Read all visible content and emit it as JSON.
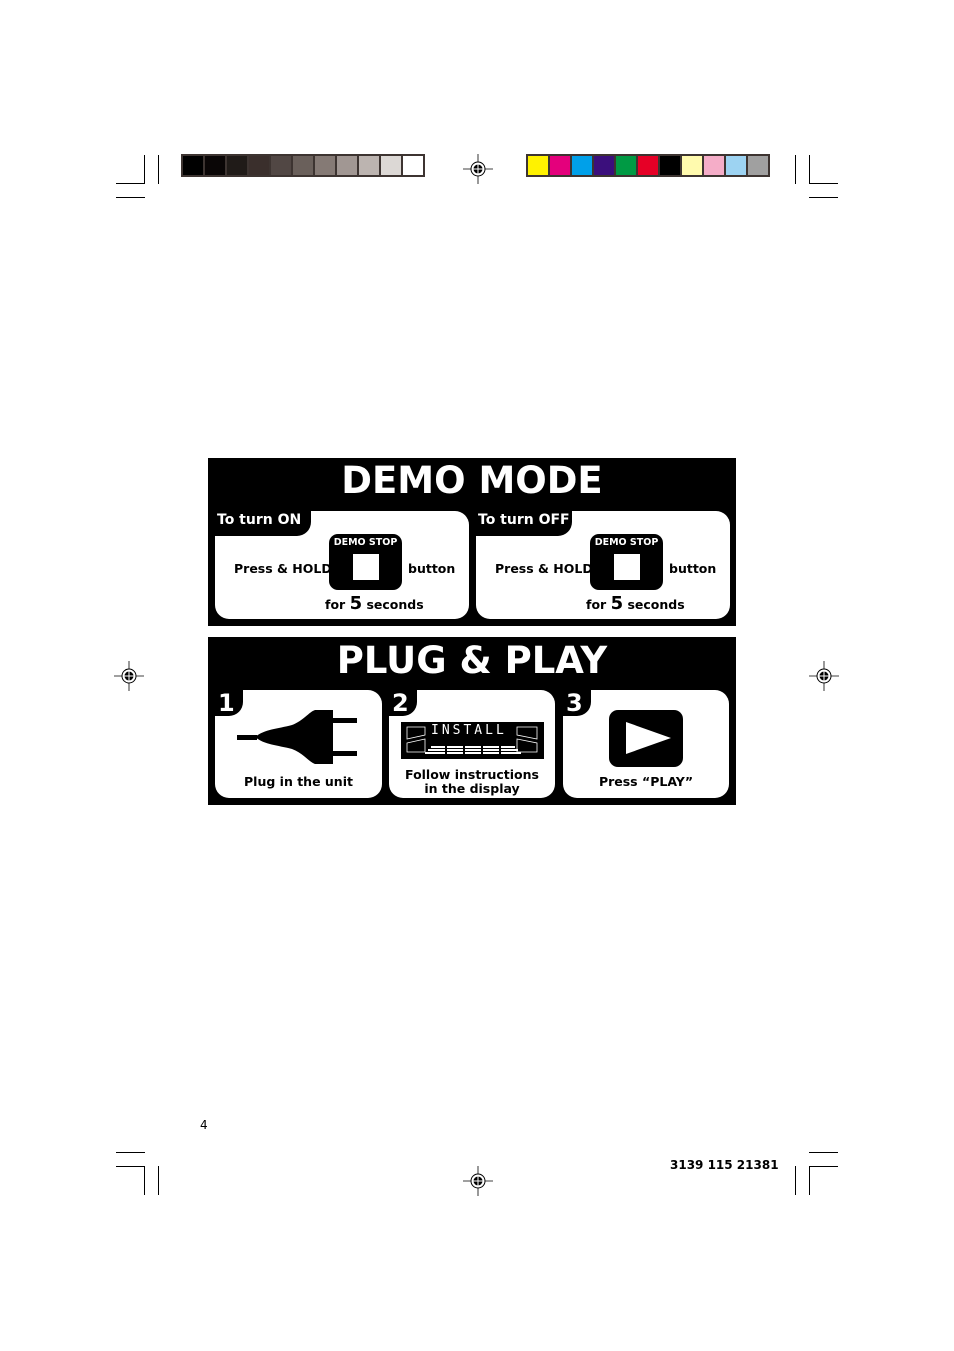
{
  "print_marks": {
    "grayscale_swatches": [
      "#000000",
      "#0a0606",
      "#201b18",
      "#3a2f2c",
      "#514744",
      "#6a605b",
      "#857a75",
      "#a19793",
      "#bcb4b0",
      "#dcd8d5",
      "#ffffff"
    ],
    "color_swatches": [
      "#fff200",
      "#e4007c",
      "#00a0e9",
      "#3b0f7c",
      "#009a44",
      "#e60026",
      "#000000",
      "#fffaae",
      "#f5adc8",
      "#9dd3f2",
      "#a0a0a0"
    ]
  },
  "demo_mode": {
    "title": "DEMO MODE",
    "turn_on": {
      "tab_label": "To turn ON",
      "press_label": "Press & HOLD",
      "button_label": "DEMO STOP",
      "after_label": "button",
      "for_label": "for",
      "seconds_value": "5",
      "seconds_label": "seconds"
    },
    "turn_off": {
      "tab_label": "To turn OFF",
      "press_label": "Press & HOLD",
      "button_label": "DEMO STOP",
      "after_label": "button",
      "for_label": "for",
      "seconds_value": "5",
      "seconds_label": "seconds"
    }
  },
  "plug_and_play": {
    "title": "PLUG & PLAY",
    "steps": [
      {
        "number": "1",
        "icon": "power-plug-icon",
        "caption": "Plug in the unit"
      },
      {
        "number": "2",
        "icon": "lcd-display-icon",
        "display_text": "INSTALL",
        "caption_line1": "Follow instructions",
        "caption_line2": "in the display"
      },
      {
        "number": "3",
        "icon": "play-button-icon",
        "caption": "Press “PLAY”"
      }
    ]
  },
  "footer": {
    "page_number": "4",
    "document_code": "3139 115 21381"
  }
}
